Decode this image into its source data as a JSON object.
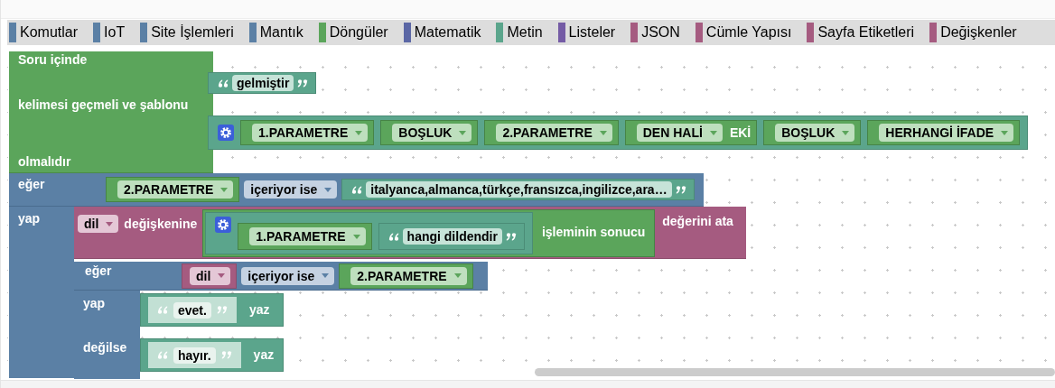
{
  "toolbox": [
    {
      "label": "Komutlar",
      "color": "#5b80a5"
    },
    {
      "label": "IoT",
      "color": "#5b80a5"
    },
    {
      "label": "Site İşlemleri",
      "color": "#5b80a5"
    },
    {
      "label": "Mantık",
      "color": "#5b80a5"
    },
    {
      "label": "Döngüler",
      "color": "#5ba55b"
    },
    {
      "label": "Matematik",
      "color": "#5b67a5"
    },
    {
      "label": "Metin",
      "color": "#5ba58c"
    },
    {
      "label": "Listeler",
      "color": "#745ba5"
    },
    {
      "label": "JSON",
      "color": "#a55b80"
    },
    {
      "label": "Cümle Yapısı",
      "color": "#a55b80"
    },
    {
      "label": "Sayfa Etiketleri",
      "color": "#a55b80"
    },
    {
      "label": "Değişkenler",
      "color": "#a55b80"
    }
  ],
  "question_block": {
    "labels": [
      "Soru içinde",
      "kelimesi geçmeli ve şablonu",
      "olmalıdır"
    ],
    "word": "gelmiştir",
    "template": [
      {
        "kind": "dropdown",
        "value": "1.PARAMETRE"
      },
      {
        "kind": "dropdown",
        "value": "BOŞLUK"
      },
      {
        "kind": "dropdown",
        "value": "2.PARAMETRE"
      },
      {
        "kind": "suffix",
        "value": "DEN HALİ",
        "suffix": "EKİ"
      },
      {
        "kind": "dropdown",
        "value": "BOŞLUK"
      },
      {
        "kind": "dropdown",
        "value": "HERHANGİ İFADE"
      }
    ]
  },
  "if_block": {
    "if_label": "eğer",
    "do_label": "yap",
    "condition": {
      "left": "2.PARAMETRE",
      "operator": "içeriyor ise",
      "text": "italyanca,almanca,türkçe,fransızca,ingilizce,ara…"
    },
    "assign": {
      "variable": "dil",
      "label": "değişkenine",
      "parts": [
        {
          "kind": "dropdown",
          "value": "1.PARAMETRE"
        },
        {
          "kind": "text",
          "value": "hangi dildendir"
        }
      ],
      "result_label": "işleminin sonucu",
      "end_label": "değerini ata"
    },
    "inner_if": {
      "if_label": "eğer",
      "do_label": "yap",
      "else_label": "değilse",
      "condition": {
        "variable": "dil",
        "operator": "içeriyor ise",
        "right": "2.PARAMETRE"
      },
      "then": {
        "text": "evet.",
        "label": "yaz"
      },
      "else": {
        "text": "hayır.",
        "label": "yaz"
      }
    }
  }
}
